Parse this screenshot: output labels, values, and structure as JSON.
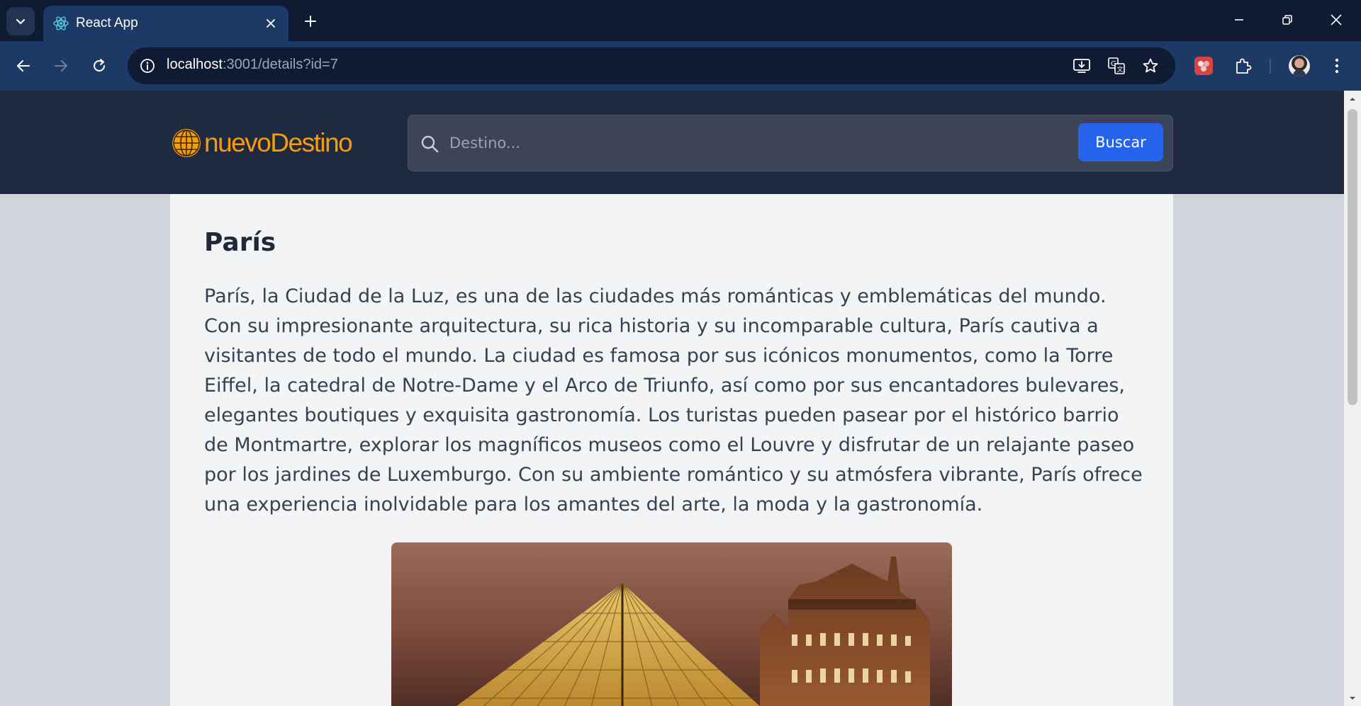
{
  "browser": {
    "tab_title": "React App",
    "url_host": "localhost",
    "url_rest": ":3001/details?id=7",
    "icons": {
      "tab_search": "chevron-down-icon",
      "favicon": "react-icon",
      "close": "close-icon",
      "new_tab": "plus-icon",
      "minimize": "minimize-icon",
      "restore": "restore-icon",
      "window_close": "close-icon",
      "back": "arrow-left-icon",
      "forward": "arrow-right-icon",
      "reload": "reload-icon",
      "site_info": "info-icon",
      "install": "install-app-icon",
      "translate": "translate-icon",
      "bookmark": "star-icon",
      "extension_app": "extension-app-icon",
      "extensions": "puzzle-icon",
      "profile": "avatar",
      "menu": "kebab-menu-icon"
    },
    "colors": {
      "tabstrip": "#0e1b33",
      "toolbar": "#1d3a66",
      "omnibox": "#0e1b33"
    }
  },
  "header": {
    "logo_text": "nuevoDestino",
    "search_placeholder": "Destino...",
    "search_button": "Buscar",
    "colors": {
      "background": "#1f2a40",
      "logo": "#f59e0b",
      "button": "#2563eb"
    }
  },
  "destination": {
    "title": "París",
    "description": "París, la Ciudad de la Luz, es una de las ciudades más románticas y emblemáticas del mundo. Con su impresionante arquitectura, su rica historia y su incomparable cultura, París cautiva a visitantes de todo el mundo. La ciudad es famosa por sus icónicos monumentos, como la Torre Eiffel, la catedral de Notre-Dame y el Arco de Triunfo, así como por sus encantadores bulevares, elegantes boutiques y exquisita gastronomía. Los turistas pueden pasear por el histórico barrio de Montmartre, explorar los magníficos museos como el Louvre y disfrutar de un relajante paseo por los jardines de Luxemburgo. Con su ambiente romántico y su atmósfera vibrante, París ofrece una experiencia inolvidable para los amantes del arte, la moda y la gastronomía."
  }
}
